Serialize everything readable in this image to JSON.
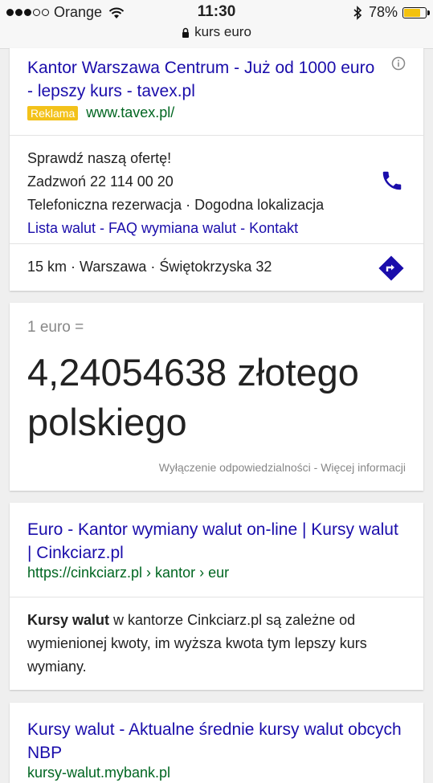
{
  "status_bar": {
    "carrier": "Orange",
    "time": "11:30",
    "battery_percent": "78%",
    "battery_level": 0.78,
    "battery_color": "#f4c20d"
  },
  "url_bar": {
    "text": "kurs euro"
  },
  "ad": {
    "title": "Kantor Warszawa Centrum - Już od 1000 euro - lepszy kurs - tavex.pl",
    "badge": "Reklama",
    "url": "www.tavex.pl/",
    "line1": "Sprawdź naszą ofertę!",
    "line2": "Zadzwoń 22 114 00 20",
    "line3": "Telefoniczna rezerwacja · Dogodna lokalizacja",
    "links": "Lista walut - FAQ wymiana walut - Kontakt",
    "address": "15 km · Warszawa · Świętokrzyska 32"
  },
  "converter": {
    "from": "1 euro =",
    "result": "4,24054638 złotego polskiego",
    "footer": "Wyłączenie odpowiedzialności - Więcej informacji"
  },
  "result1": {
    "title": "Euro - Kantor wymiany walut on-line | Kursy walut | Cinkciarz.pl",
    "url": "https://cinkciarz.pl › kantor › eur",
    "desc_bold": "Kursy walut",
    "desc_rest": " w kantorze Cinkciarz.pl są zależne od wymienionej kwoty, im wyższa kwota tym lepszy kurs wymiany."
  },
  "result2": {
    "title": "Kursy walut - Aktualne średnie kursy walut obcych NBP",
    "url": "kursy-walut.mybank.pl"
  },
  "colors": {
    "link": "#1a0dab",
    "url_green": "#006621",
    "ad_badge": "#f3c21a",
    "icon_blue": "#1a0dab"
  },
  "icons": [
    "wifi-icon",
    "bluetooth-icon",
    "lock-icon",
    "info-icon",
    "phone-icon",
    "directions-icon"
  ]
}
